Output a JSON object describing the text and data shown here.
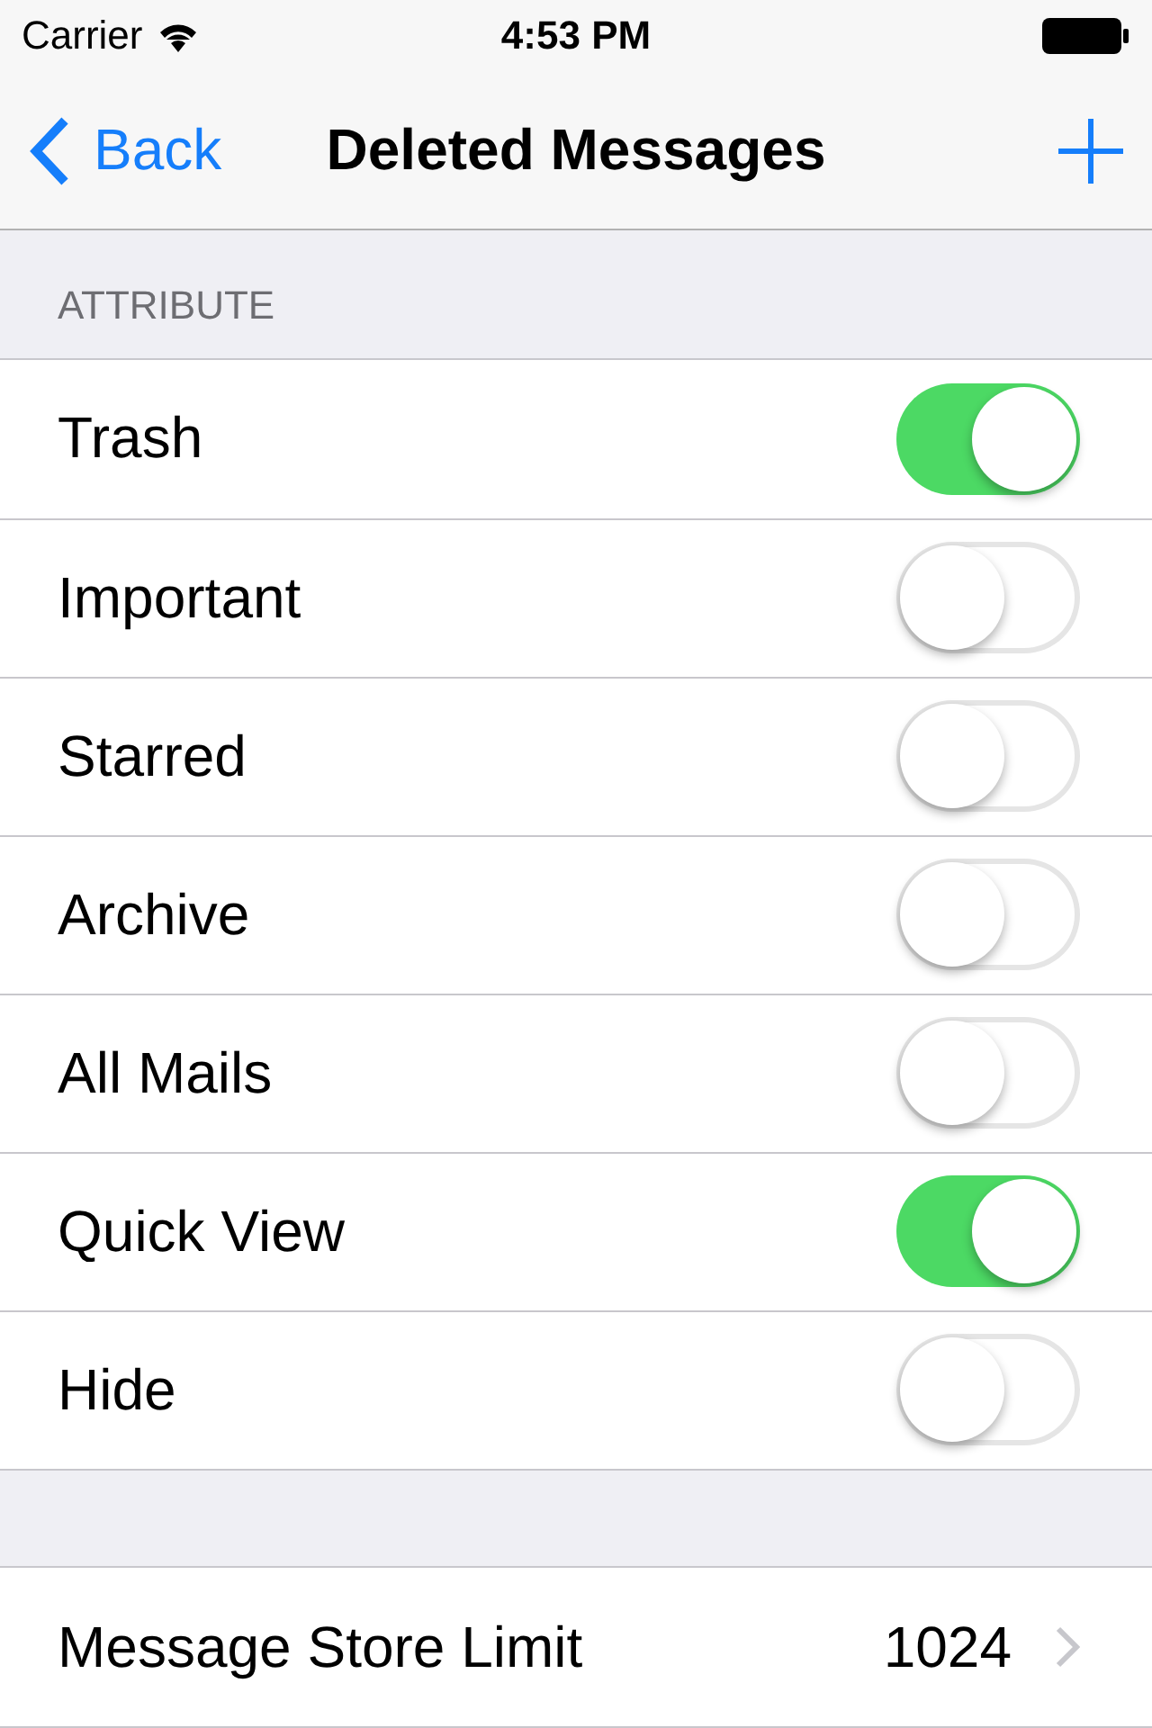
{
  "status_bar": {
    "carrier": "Carrier",
    "time": "4:53 PM"
  },
  "nav_bar": {
    "back": "Back",
    "title": "Deleted Messages"
  },
  "section": {
    "header": "ATTRIBUTE",
    "rows": [
      {
        "label": "Trash",
        "on": true
      },
      {
        "label": "Important",
        "on": false
      },
      {
        "label": "Starred",
        "on": false
      },
      {
        "label": "Archive",
        "on": false
      },
      {
        "label": "All Mails",
        "on": false
      },
      {
        "label": "Quick View",
        "on": true
      },
      {
        "label": "Hide",
        "on": false
      }
    ]
  },
  "limit_row": {
    "label": "Message Store Limit",
    "value": "1024"
  }
}
